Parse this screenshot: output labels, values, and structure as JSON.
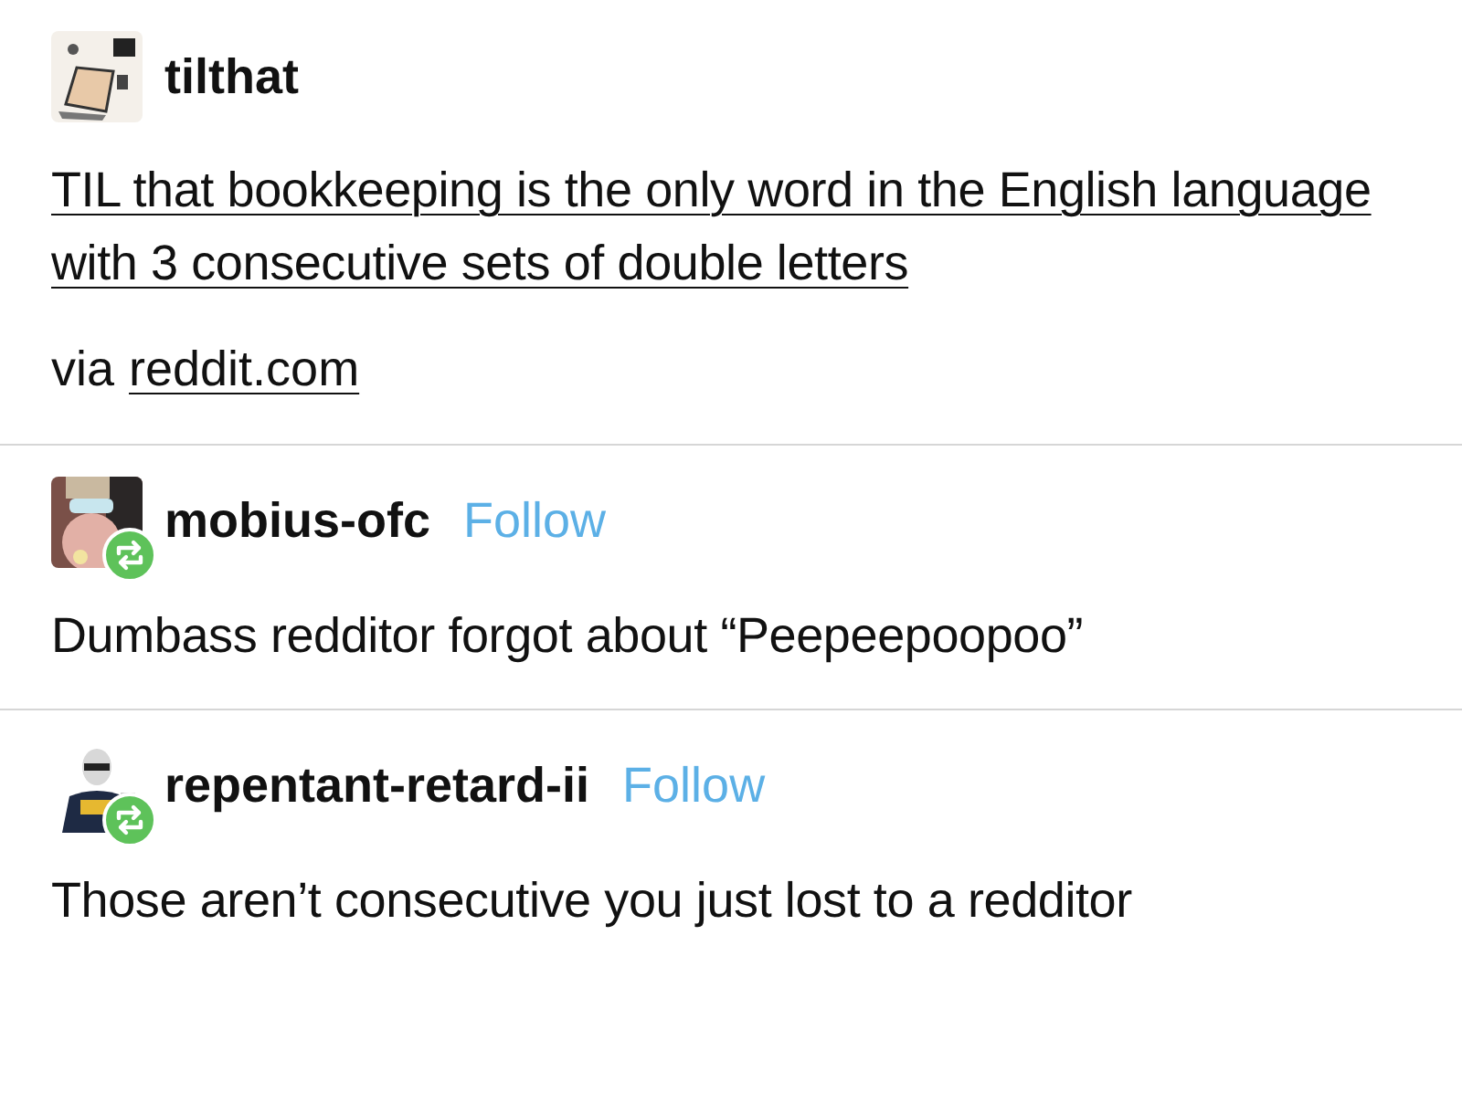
{
  "post": {
    "blog": "tilthat",
    "title": "TIL that bookkeeping is the only word in the English language with 3 consecutive sets of double letters",
    "source_prefix": "via",
    "source_link": "reddit.com"
  },
  "reblogs": [
    {
      "blog": "mobius-ofc",
      "follow": "Follow",
      "text": "Dumbass redditor forgot about “Peepeepoopoo”"
    },
    {
      "blog": "repentant-retard-ii",
      "follow": "Follow",
      "text": "Those aren’t consecutive you just lost to a redditor"
    }
  ]
}
